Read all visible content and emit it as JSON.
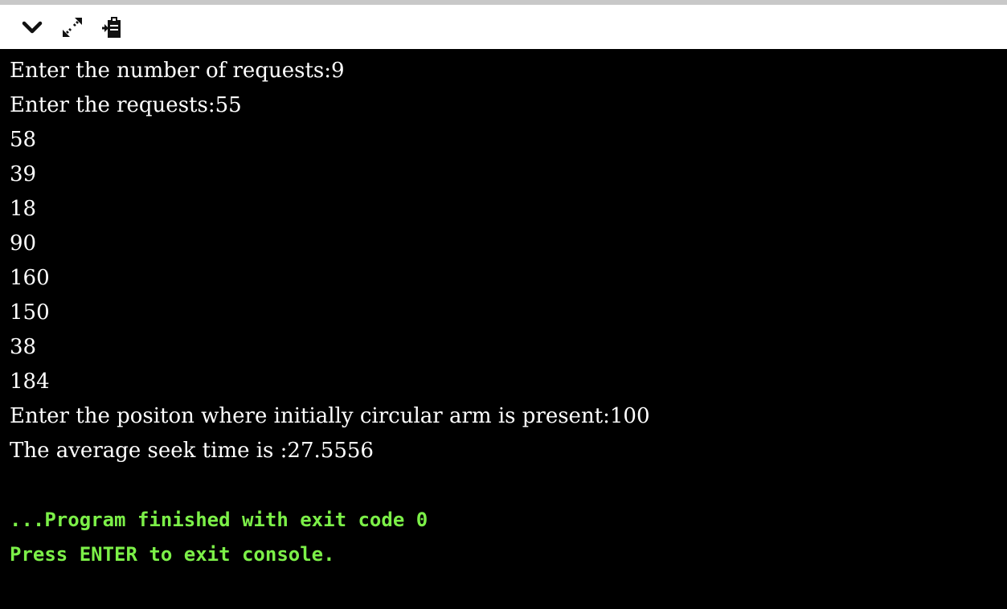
{
  "toolbar": {
    "icons": [
      "chevron-down-icon",
      "expand-icon",
      "clipboard-icon"
    ]
  },
  "colors": {
    "console_bg": "#000000",
    "console_text": "#ffffff",
    "status_text": "#7cf048",
    "toolbar_bg": "#ffffff"
  },
  "console": {
    "lines": [
      "Enter the number of requests:9",
      "Enter the requests:55",
      "58",
      "39",
      "18",
      "90",
      "160",
      "150",
      "38",
      "184",
      "Enter the positon where initially circular arm is present:100",
      "The average seek time is :27.5556"
    ],
    "status_lines": [
      "...Program finished with exit code 0",
      "Press ENTER to exit console."
    ]
  }
}
